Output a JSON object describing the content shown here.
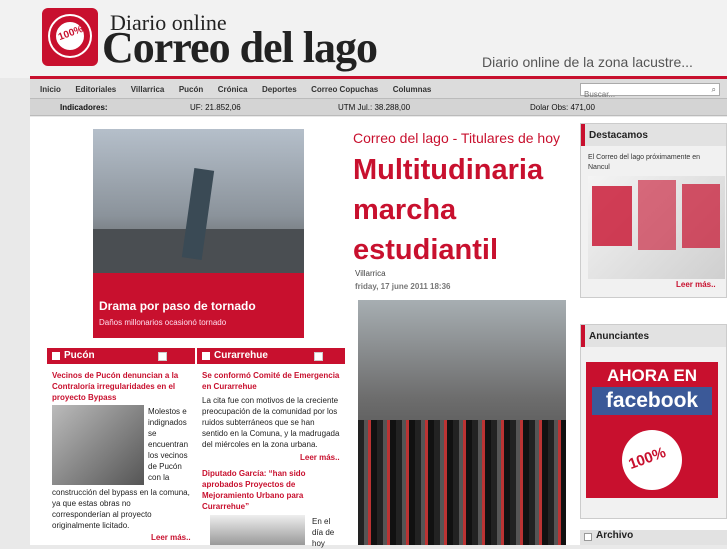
{
  "header": {
    "logo_small": "Diario online",
    "logo_big": "Correo del lago",
    "logo_badge": "100%",
    "tagline": "Diario online de la zona lacustre..."
  },
  "nav": {
    "items": [
      "Inicio",
      "Editoriales",
      "Villarrica",
      "Pucón",
      "Crónica",
      "Deportes",
      "Correo Copuchas",
      "Columnas"
    ],
    "search_placeholder": "Buscar..."
  },
  "indicators": {
    "label": "Indicadores:",
    "uf": "UF: 21.852,06",
    "utm": "UTM Jul.: 38.288,00",
    "dolar": "Dolar Obs: 471,00"
  },
  "featured": {
    "title": "Drama por paso de tornado",
    "subtitle": "Daños millonarios ocasionó tornado"
  },
  "pucon": {
    "label": "Pucón",
    "story_title": "Vecinos de Pucón denuncian a la Contraloría irregularidades en el proyecto Bypass",
    "body_side": [
      "Molestos e",
      "indignados",
      "se",
      "encuentran",
      "los vecinos",
      "de Pucón",
      "con la"
    ],
    "body_full": [
      "construcción del bypass en la comuna,",
      "ya que estas obras no",
      "corresponderían al proyecto",
      "originalmente licitado."
    ],
    "more": "Leer más.."
  },
  "curarrehue": {
    "label": "Curarrehue",
    "story1_title": "Se conformó Comité de Emergencia en Curarrehue",
    "story1_body": [
      "La cita fue con motivos de la creciente",
      "preocupación de la comunidad por los",
      "ruidos subterráneos que se han",
      "sentido en la Comuna, y la madrugada",
      "del miércoles en la zona urbana."
    ],
    "more": "Leer más..",
    "story2_title": "Diputado García: “han sido aprobados Proyectos de Mejoramiento Urbano para Curarrehue”",
    "story2_body": [
      "En el",
      "día de",
      "hoy"
    ]
  },
  "headline": {
    "kicker": "Correo del lago - Titulares de hoy",
    "title": "Multitudinaria marcha estudiantil",
    "place": "Villarrica",
    "date": "friday, 17 june 2011 18:36"
  },
  "sidebar": {
    "destacamos_title": "Destacamos",
    "destacamos_text": "El Correo del lago próximamente en Nancul",
    "destacamos_more": "Leer más..",
    "anunciantes_title": "Anunciantes",
    "ad_line1": "AHORA EN",
    "ad_line2": "facebook",
    "ad_badge": "100%",
    "archivo_title": "Archivo"
  }
}
